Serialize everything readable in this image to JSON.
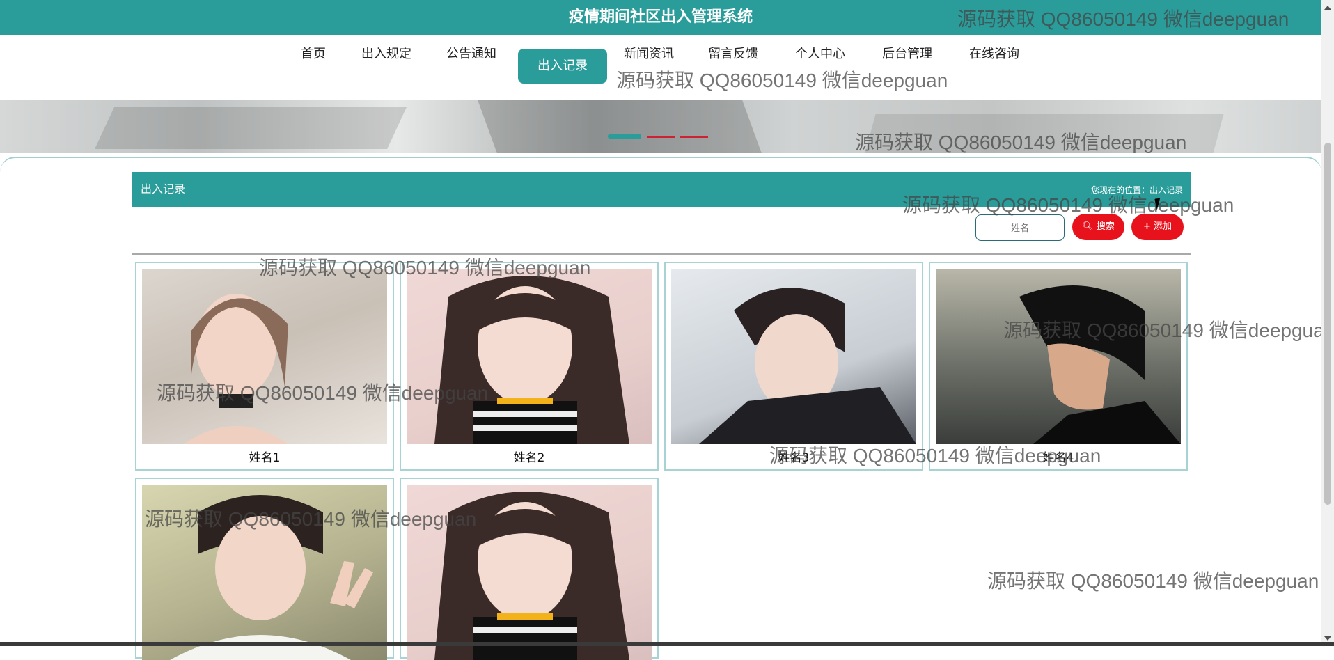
{
  "app": {
    "title": "疫情期间社区出入管理系统"
  },
  "nav": {
    "items": [
      {
        "label": "首页"
      },
      {
        "label": "出入规定"
      },
      {
        "label": "公告通知"
      },
      {
        "label": "出入记录"
      },
      {
        "label": "新闻资讯"
      },
      {
        "label": "留言反馈"
      },
      {
        "label": "个人中心"
      },
      {
        "label": "后台管理"
      },
      {
        "label": "在线咨询"
      }
    ],
    "active_index": 3
  },
  "section": {
    "title": "出入记录",
    "breadcrumb": "您现在的位置：出入记录"
  },
  "search": {
    "placeholder": "姓名",
    "search_label": "搜索",
    "add_label": "添加"
  },
  "cards": [
    {
      "name": "姓名1"
    },
    {
      "name": "姓名2"
    },
    {
      "name": "姓名3"
    },
    {
      "name": "姓名4"
    },
    {
      "name": ""
    },
    {
      "name": ""
    }
  ],
  "watermark": {
    "text": "源码获取 QQ86050149 微信deepguan"
  },
  "colors": {
    "primary": "#2a9d9b",
    "danger": "#e8121d"
  }
}
